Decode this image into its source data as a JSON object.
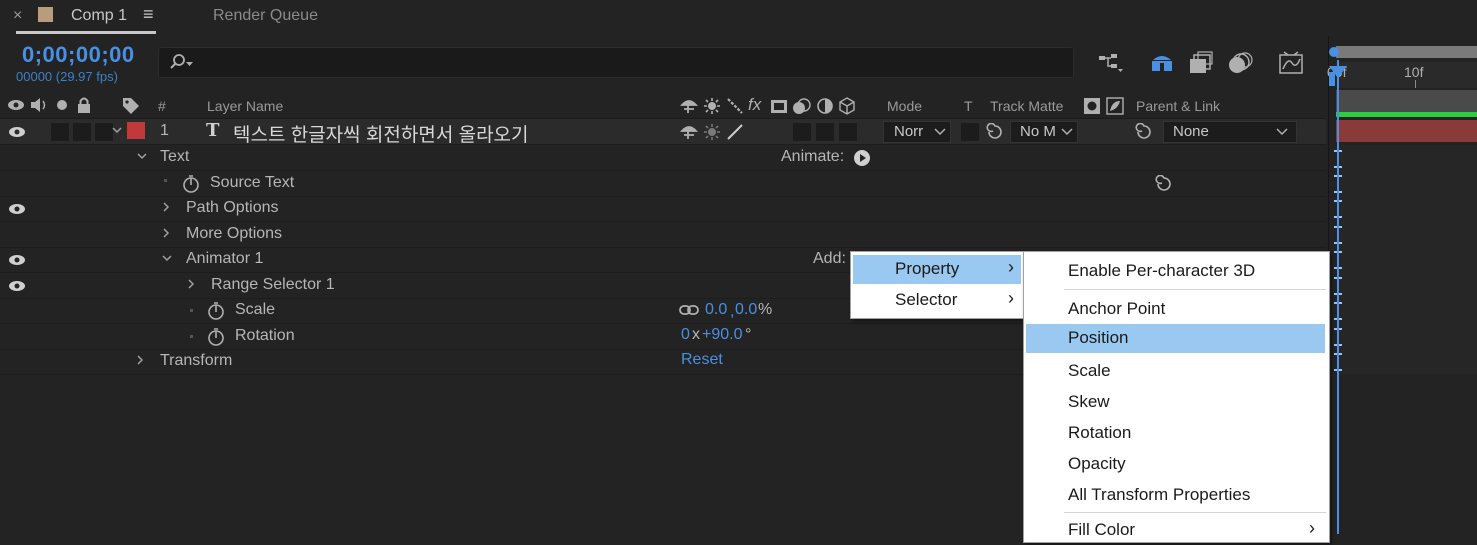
{
  "tabs": {
    "close_glyph": "×",
    "comp_tab": "Comp 1",
    "menu_glyph": "≡",
    "render_tab": "Render Queue"
  },
  "header": {
    "timecode": "0;00;00;00",
    "frames": "00000 (29.97 fps)",
    "search_placeholder": ""
  },
  "columns": {
    "num": "#",
    "layer_name": "Layer Name",
    "fx": "fx",
    "mode": "Mode",
    "t": "T",
    "track_matte": "Track Matte",
    "parent_link": "Parent & Link"
  },
  "layer": {
    "number": "1",
    "type_glyph": "T",
    "name": "텍스트 한글자씩 회전하면서 올라오기",
    "label_color": "#c2393b",
    "mode": "Norr",
    "track_matte": "No M",
    "parent": "None"
  },
  "properties": {
    "text": "Text",
    "animate": "Animate:",
    "source_text": "Source Text",
    "path_options": "Path Options",
    "more_options": "More Options",
    "animator": "Animator 1",
    "add": "Add:",
    "range_selector": "Range Selector 1",
    "scale": "Scale",
    "scale_x": "0.0",
    "scale_sep": ",",
    "scale_y": "0.0",
    "scale_unit": "%",
    "rotation": "Rotation",
    "rotation_rev": "0",
    "rotation_x": "x",
    "rotation_deg": "+90.0",
    "rotation_unit": "°",
    "transform": "Transform",
    "reset": "Reset"
  },
  "timeline": {
    "tick_0": "00f",
    "tick_10": "10f",
    "layer_bar_color": "#8b3a3a",
    "work_area_color": "#2ecc40"
  },
  "add_menu": {
    "items": [
      "Property",
      "Selector"
    ],
    "submenu_arrow": "›"
  },
  "property_menu": {
    "items": [
      "Enable Per-character 3D",
      "Anchor Point",
      "Position",
      "Scale",
      "Skew",
      "Rotation",
      "Opacity",
      "All Transform Properties",
      "Fill Color"
    ],
    "fill_arrow": "›"
  },
  "colors": {
    "accent_blue": "#4a90e2",
    "menu_highlight": "#99c9f1",
    "panel_bg": "#232323"
  }
}
